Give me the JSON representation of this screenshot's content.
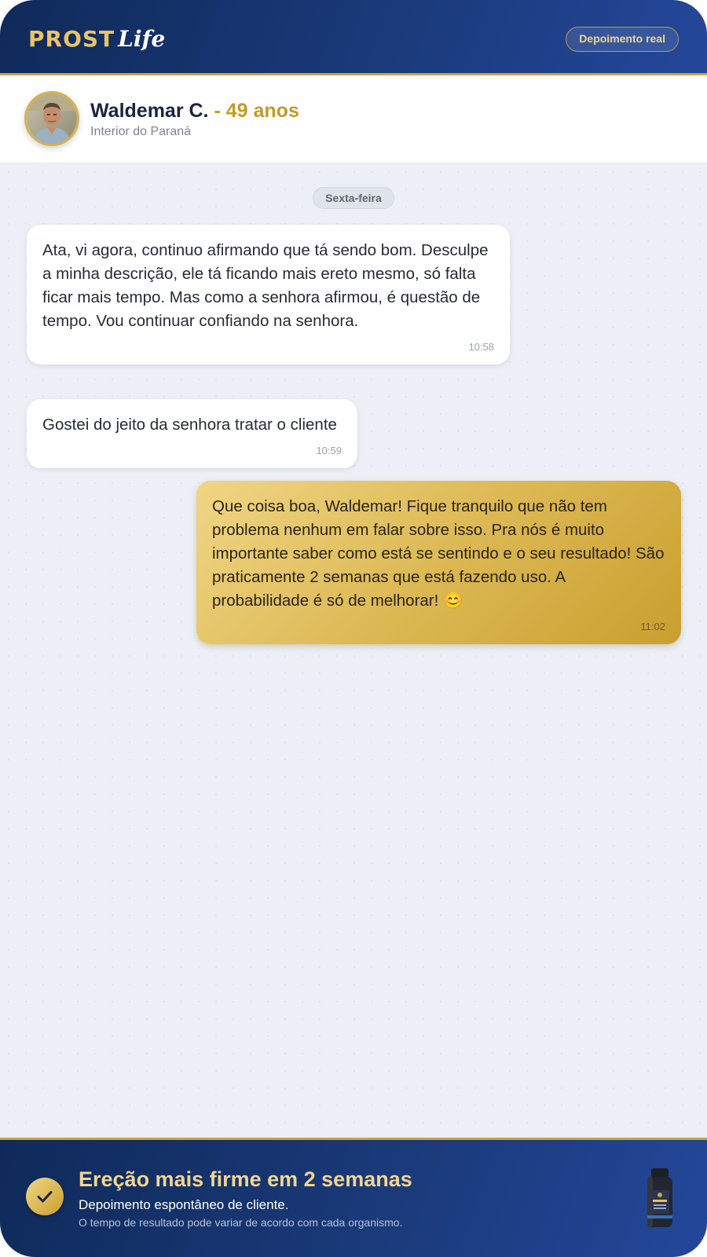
{
  "header": {
    "logo_primary": "PROST",
    "logo_secondary": "Life",
    "badge": "Depoimento real"
  },
  "profile": {
    "name": "Waldemar C.",
    "age": "- 49 anos",
    "location": "Interior do Paraná"
  },
  "chat": {
    "day_label": "Sexta-feira",
    "messages": [
      {
        "direction": "incoming",
        "text": "Ata, vi agora, continuo afirmando que tá sendo bom. Desculpe a minha descrição, ele tá ficando mais ereto mesmo, só falta ficar mais tempo. Mas como a senhora afirmou, é questão de tempo. Vou continuar confiando na senhora.",
        "time": "10:58"
      },
      {
        "direction": "incoming",
        "text": "Gostei do jeito da senhora tratar o cliente",
        "time": "10:59"
      },
      {
        "direction": "outgoing",
        "text": "Que coisa boa, Waldemar! Fique tranquilo que não tem problema nenhum em falar sobre isso. Pra nós é muito importante saber como está se sentindo e o seu resultado! São praticamente 2 semanas que está fazendo uso. A probabilidade é só de melhorar! 😊",
        "time": "11:02"
      }
    ]
  },
  "footer": {
    "title": "Ereção mais firme em 2 semanas",
    "subtitle": "Depoimento espontâneo de cliente.",
    "note": "O tempo de resultado pode variar de acordo com cada organismo.",
    "icon": "check-icon"
  },
  "colors": {
    "navy": "#1a3a7a",
    "gold": "#c9a640",
    "gold_light": "#f0d592",
    "chat_bg": "#eceff5"
  }
}
